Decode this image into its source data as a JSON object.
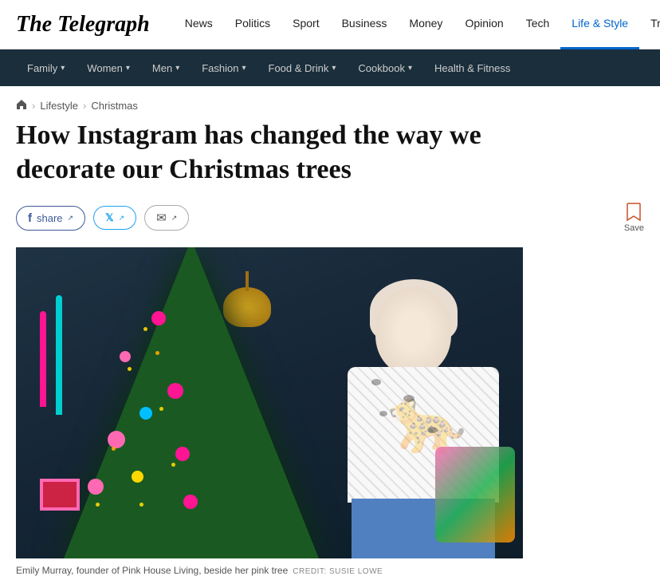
{
  "site": {
    "name": "The Telegraph"
  },
  "topNav": {
    "links": [
      {
        "label": "News",
        "active": false
      },
      {
        "label": "Politics",
        "active": false
      },
      {
        "label": "Sport",
        "active": false
      },
      {
        "label": "Business",
        "active": false
      },
      {
        "label": "Money",
        "active": false
      },
      {
        "label": "Opinion",
        "active": false
      },
      {
        "label": "Tech",
        "active": false
      },
      {
        "label": "Life & Style",
        "active": true
      },
      {
        "label": "Travel",
        "active": false
      }
    ]
  },
  "subNav": {
    "links": [
      {
        "label": "Family",
        "hasChevron": true,
        "active": false
      },
      {
        "label": "Women",
        "hasChevron": true,
        "active": false
      },
      {
        "label": "Men",
        "hasChevron": true,
        "active": false
      },
      {
        "label": "Fashion",
        "hasChevron": true,
        "active": false
      },
      {
        "label": "Food & Drink",
        "hasChevron": true,
        "active": false
      },
      {
        "label": "Cookbook",
        "hasChevron": true,
        "active": false
      },
      {
        "label": "Health & Fitness",
        "hasChevron": false,
        "active": false
      }
    ]
  },
  "breadcrumb": {
    "home": "Home",
    "items": [
      {
        "label": "Lifestyle",
        "href": "#"
      },
      {
        "label": "Christmas",
        "href": "#"
      }
    ]
  },
  "article": {
    "title": "How Instagram has changed the way we decorate our Christmas trees",
    "shareButtons": [
      {
        "label": "share",
        "type": "facebook",
        "icon": "f"
      },
      {
        "label": "",
        "type": "twitter",
        "icon": "t"
      },
      {
        "label": "",
        "type": "email",
        "icon": "✉"
      }
    ],
    "saveLabel": "Save",
    "imageCaption": "Emily Murray, founder of Pink House Living, beside her pink tree",
    "imageCredit": "CREDIT: SUSIE LOWE"
  }
}
